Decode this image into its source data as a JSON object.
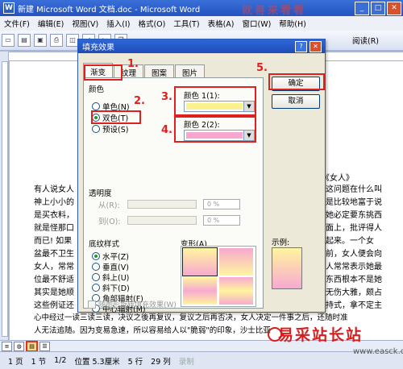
{
  "window": {
    "title": "新建 Microsoft Word 文档.doc - Microsoft Word",
    "overlay_text": "就善来看看"
  },
  "menubar": [
    "文件(F)",
    "编辑(E)",
    "视图(V)",
    "插入(I)",
    "格式(O)",
    "工具(T)",
    "表格(A)",
    "窗口(W)",
    "帮助(H)"
  ],
  "toolbar": {
    "read_label": "阅读(R)"
  },
  "document": {
    "title_fragment": "(《女人》",
    "left_col": [
      "有人说女人",
      "神上小小的",
      "是买衣料，",
      "就是怪那口",
      "而已! 如果",
      "盆最不卫生",
      "女人，常常",
      "位最不舒适",
      "其实是她顺",
      "这些例证还"
    ],
    "right_col": [
      "这问题在什么叫",
      "是比较地富于说",
      "她必定要东挑西",
      "面上，批评得人",
      "起来。一个女",
      "前，女人便会向",
      "人常常表示她最",
      "东西根本不是她",
      "无伤大雅，颇占",
      "持式，拿不定主"
    ],
    "bottom_lines": [
      "心中经过一读三读三读，决议之後再复议，复议之后再否决，女人决定一件事之后，还随时准",
      "人无法追随。因为变易急速，所以容易给人以\"脆弱\"的印象，沙士比亚"
    ]
  },
  "dialog": {
    "title": "填充效果",
    "tabs": [
      "渐变",
      "纹理",
      "图案",
      "图片"
    ],
    "colors_group": "颜色",
    "radio_single": "单色(N)",
    "radio_double": "双色(T)",
    "radio_preset": "预设(S)",
    "color1_label": "颜色 1(1):",
    "color2_label": "颜色 2(2):",
    "color1_hex": "#fbf28e",
    "color2_hex": "#f6a6cf",
    "transparency_group": "透明度",
    "from_label": "从(R):",
    "to_label": "到(O):",
    "from_value": "0 %",
    "to_value": "0 %",
    "shading_group": "底纹样式",
    "shading_styles": [
      "水平(Z)",
      "垂直(V)",
      "斜上(U)",
      "斜下(D)",
      "角部辐射(F)",
      "中心辐射(M)"
    ],
    "variants_label": "变形(A)",
    "sample_label": "示例:",
    "rotate_label": "随图形旋转填充效果(W)",
    "ok_label": "确定",
    "cancel_label": "取消"
  },
  "annotations": [
    "1.",
    "2.",
    "3.",
    "4.",
    "5."
  ],
  "statusbar": [
    "1 页",
    "1 节",
    "1/2",
    "位置 5.3厘米",
    "5 行",
    "29 列",
    "录制"
  ],
  "watermark": {
    "main": "易采站长站",
    "url": "www.easck.com"
  }
}
